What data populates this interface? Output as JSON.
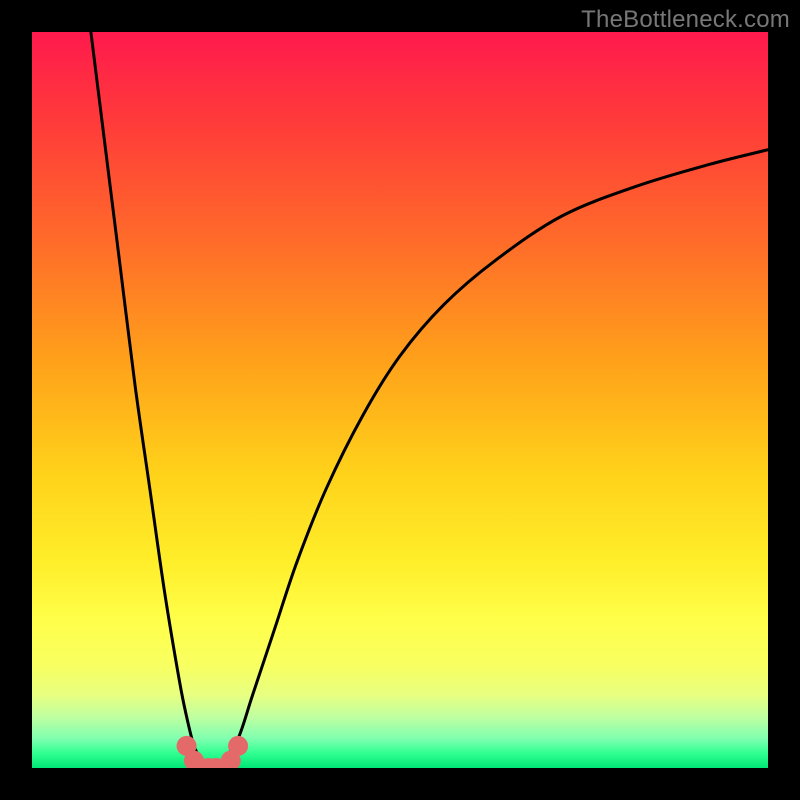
{
  "watermark": "TheBottleneck.com",
  "chart_data": {
    "type": "line",
    "title": "",
    "xlabel": "",
    "ylabel": "",
    "xlim": [
      0,
      100
    ],
    "ylim": [
      0,
      100
    ],
    "series": [
      {
        "name": "left-descent",
        "x": [
          8,
          10,
          12,
          14,
          16,
          18,
          20,
          21,
          22,
          23
        ],
        "y": [
          100,
          84,
          68,
          52,
          38,
          24,
          12,
          7,
          3,
          1
        ]
      },
      {
        "name": "valley",
        "x": [
          21,
          22,
          23,
          24,
          25,
          26,
          27,
          28
        ],
        "y": [
          3,
          1,
          0,
          0,
          0,
          0,
          1,
          3
        ]
      },
      {
        "name": "right-ascent",
        "x": [
          26,
          28,
          30,
          33,
          36,
          40,
          45,
          50,
          56,
          63,
          72,
          82,
          92,
          100
        ],
        "y": [
          1,
          4,
          10,
          19,
          28,
          38,
          48,
          56,
          63,
          69,
          75,
          79,
          82,
          84
        ]
      }
    ],
    "markers": {
      "name": "valley-dots",
      "x": [
        21,
        22,
        23,
        24,
        25,
        26,
        27,
        28
      ],
      "y": [
        3,
        1,
        0,
        0,
        0,
        0,
        1,
        3
      ]
    },
    "colors": {
      "curve": "#000000",
      "marker": "#e46a6a",
      "gradient_top": "#ff1a4d",
      "gradient_bottom": "#00e676"
    }
  }
}
